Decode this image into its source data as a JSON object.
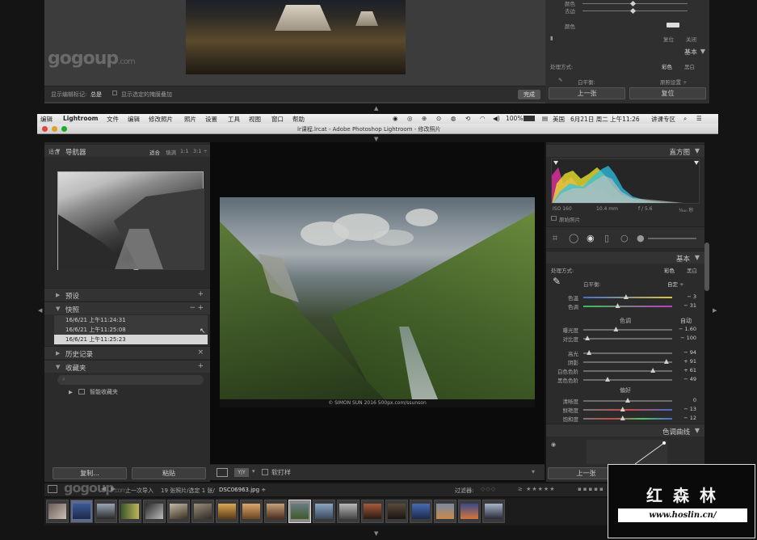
{
  "prev_window": {
    "watermark": "gogoup",
    "watermark_suffix": ".com",
    "toolbar_label": "显示编辑标记:",
    "toolbar_value": "总是",
    "toolbar_check": "显示选定的掩膜叠加",
    "done": "完成",
    "slider1": "颜色",
    "slider2": "去边",
    "color_label": "颜色",
    "reset": "复位",
    "close": "关闭",
    "basic": "基本",
    "treatment": "处理方式:",
    "color": "彩色",
    "bw": "黑白",
    "wb": "白平衡:",
    "wb_value": "原照设置 ÷",
    "btn_prev": "上一张",
    "btn_reset": "复位"
  },
  "menubar": {
    "items": [
      "编辑",
      "Lightroom",
      "文件",
      "编辑",
      "修改照片",
      "照片",
      "设置",
      "工具",
      "视图",
      "窗口",
      "帮助"
    ],
    "battery": "100%",
    "input_method": "美国",
    "clock": "6月21日 周二 上午11:26",
    "user": "讲课专区"
  },
  "window_title": "lr课程.lrcat - Adobe Photoshop Lightroom - 修改照片",
  "left_panel": {
    "navigator": "导航器",
    "nav_opts": [
      "适合",
      "填满",
      "1:1",
      "3:1 ÷"
    ],
    "zoom_label": "适合",
    "presets": "预设",
    "snapshots": "快照",
    "snapshot_items": [
      "16/6/21 上午11:24:31",
      "16/6/21 上午11:25:08",
      "16/6/21 上午11:25:23"
    ],
    "history": "历史记录",
    "collections": "收藏夹",
    "smart_collection": "智能收藏夹",
    "copy_btn": "复制...",
    "paste_btn": "粘贴"
  },
  "center": {
    "credit": "© SIMON SUN 2016      500px.com/ssunson",
    "soft_proof": "软打样",
    "watermark": "gogoup",
    "watermark_suffix": ".com"
  },
  "right_panel": {
    "histogram": "直方图",
    "iso": "ISO 160",
    "focal": "10.4 mm",
    "aperture": "f / 5.6",
    "shutter": "¹⁄₆₄₀ 秒",
    "original": "原始照片",
    "basic": "基本",
    "treatment": "处理方式:",
    "color": "彩色",
    "bw": "黑白",
    "wb": "白平衡:",
    "wb_value": "自定 ÷",
    "tone": "色调",
    "auto": "自动",
    "presence": "偏好",
    "tone_curve": "色调曲线",
    "btn_prev": "上一张",
    "btn_reset": "复位",
    "sliders": [
      {
        "label": "色温",
        "value": "− 3",
        "pos": 0.48
      },
      {
        "label": "色调",
        "value": "− 31",
        "pos": 0.38
      },
      {
        "label": "曝光度",
        "value": "− 1.60",
        "pos": 0.36
      },
      {
        "label": "对比度",
        "value": "− 100",
        "pos": 0.02
      },
      {
        "label": "高光",
        "value": "− 94",
        "pos": 0.04
      },
      {
        "label": "阴影",
        "value": "+ 91",
        "pos": 0.96
      },
      {
        "label": "白色色阶",
        "value": "+ 61",
        "pos": 0.8
      },
      {
        "label": "黑色色阶",
        "value": "− 49",
        "pos": 0.26
      },
      {
        "label": "清晰度",
        "value": "0",
        "pos": 0.5
      },
      {
        "label": "鲜艳度",
        "value": "− 13",
        "pos": 0.44
      },
      {
        "label": "饱和度",
        "value": "− 12",
        "pos": 0.44
      }
    ]
  },
  "filmstrip": {
    "source": "上一次导入",
    "count": "19 张照片/选定 1 张/",
    "filename": "DSC06963.jpg ÷",
    "filter": "过滤器:"
  },
  "watermark": {
    "name": "红 森 林",
    "url": "www.hoslin.cn/"
  }
}
